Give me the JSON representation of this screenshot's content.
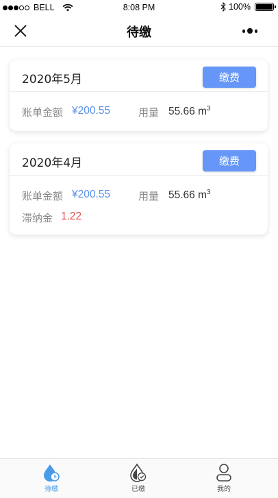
{
  "status_bar": {
    "carrier": "BELL",
    "time": "8:08 PM",
    "battery": "100%"
  },
  "nav": {
    "title": "待缴"
  },
  "bills": [
    {
      "month": "2020年5月",
      "pay_label": "缴费",
      "amount_label": "账单金额",
      "amount": "¥200.55",
      "usage_label": "用量",
      "usage": "55.66 m",
      "usage_unit_sup": "3"
    },
    {
      "month": "2020年4月",
      "pay_label": "缴费",
      "amount_label": "账单金额",
      "amount": "¥200.55",
      "usage_label": "用量",
      "usage": "55.66 m",
      "usage_unit_sup": "3",
      "late_fee_label": "滞纳金",
      "late_fee": "1.22"
    }
  ],
  "tabs": [
    {
      "label": "待缴",
      "icon": "water-drop-clock-icon",
      "active": true
    },
    {
      "label": "已缴",
      "icon": "water-drop-check-icon",
      "active": false
    },
    {
      "label": "我的",
      "icon": "user-icon",
      "active": false
    }
  ],
  "colors": {
    "accent": "#6697f8",
    "amount": "#5b8fe8",
    "late_fee": "#e05050",
    "active_tab": "#4a9be8"
  }
}
